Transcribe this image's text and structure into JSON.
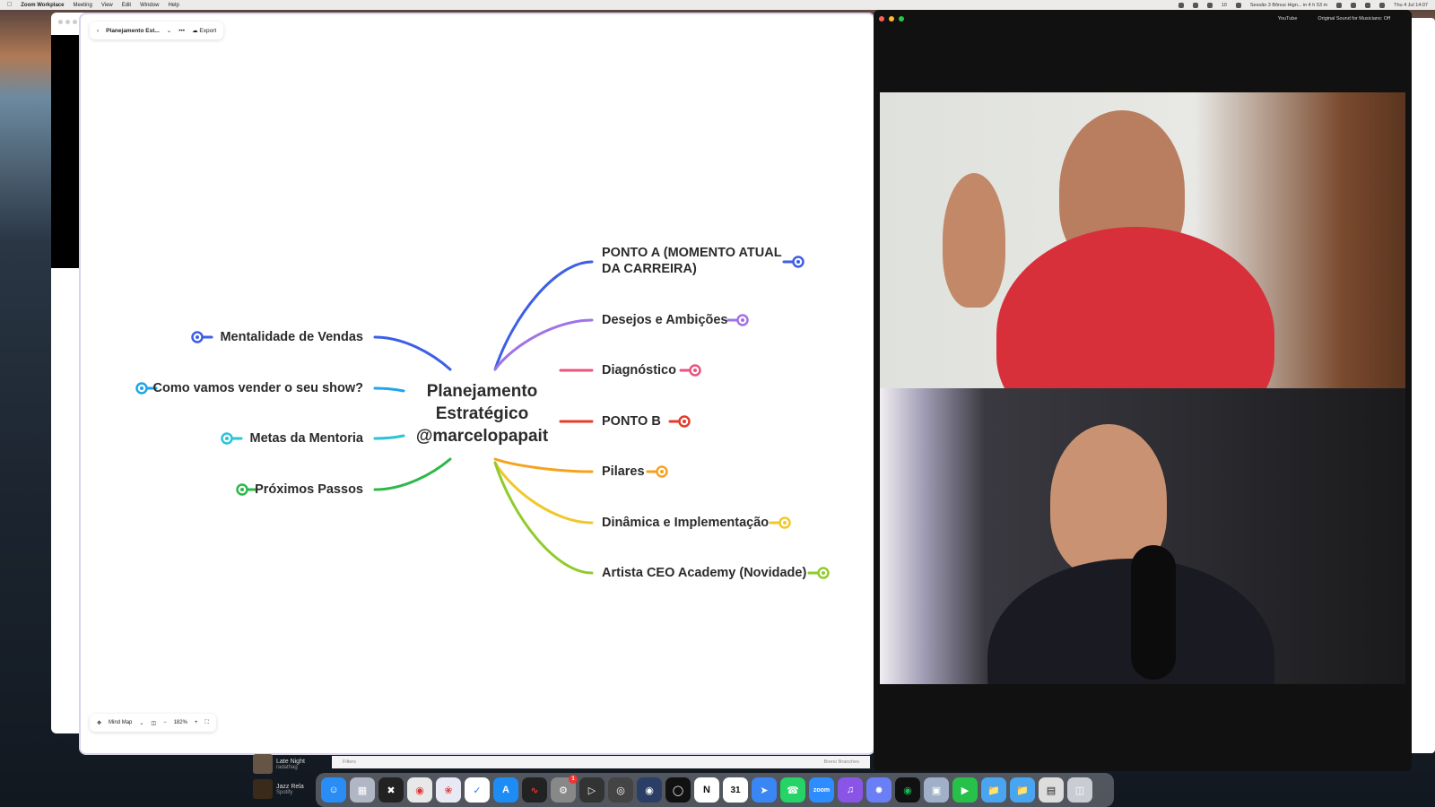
{
  "menubar": {
    "app_name": "Zoom Workplace",
    "menus": [
      "Meeting",
      "View",
      "Edit",
      "Window",
      "Help"
    ],
    "battery": "10",
    "event": "Sessão 3 Bônus Hign... in 4 h 53 m",
    "datetime": "Thu 4 Jul 14:07"
  },
  "mindmap": {
    "toolbar": {
      "title": "Planejamento Est...",
      "more": "•••",
      "export_label": "Export"
    },
    "central": [
      "Planejamento",
      "Estratégico",
      "@marcelopapait"
    ],
    "right_nodes": [
      {
        "label": "PONTO A (MOMENTO ATUAL DA CARREIRA)",
        "color": "#3d5ee6"
      },
      {
        "label": "Desejos e Ambições",
        "color": "#a073e6"
      },
      {
        "label": "Diagnóstico",
        "color": "#e8557f"
      },
      {
        "label": "PONTO B",
        "color": "#e53c2a"
      },
      {
        "label": "Pilares",
        "color": "#f5a31e"
      },
      {
        "label": "Dinâmica e Implementação",
        "color": "#f2c72a"
      },
      {
        "label": "Artista CEO Academy (Novidade)",
        "color": "#8fcc2a"
      }
    ],
    "left_nodes": [
      {
        "label": "Mentalidade de Vendas",
        "color": "#3d5ee6"
      },
      {
        "label": "Como vamos vender o seu show?",
        "color": "#1fa5e8"
      },
      {
        "label": "Metas da Mentoria",
        "color": "#2bc4d4"
      },
      {
        "label": "Próximos Passos",
        "color": "#2eb84b"
      }
    ],
    "bottombar": {
      "mode_label": "Mind Map",
      "zoom_level": "182%",
      "minus": "−",
      "plus": "+"
    }
  },
  "zoom": {
    "youtube_label": "YouTube",
    "sound_label": "Original Sound for Musicians: Off"
  },
  "spotify": {
    "track1": "Late Night",
    "artist1": "radathag",
    "track2": "Jazz Rela",
    "artist2": "Spotify"
  },
  "background_app": {
    "filters_label": "Filters",
    "user_label": "Breno Branches"
  },
  "dock": {
    "notes_badge": "1",
    "calendar_day": "31",
    "zoom_label": "zoom"
  }
}
